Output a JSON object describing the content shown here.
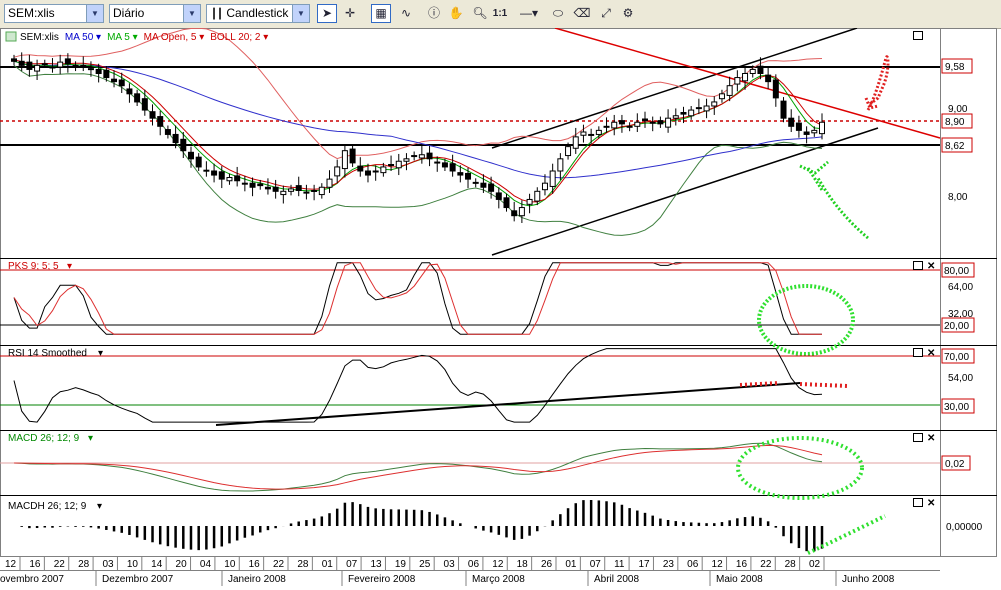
{
  "toolbar": {
    "symbol": "SEM:xlis",
    "period": "Diário",
    "chart_type": "Candlestick",
    "zoom_label": "1:1"
  },
  "panels": {
    "price": {
      "legend": [
        {
          "text": "SEM:xlis",
          "color": "#000000"
        },
        {
          "text": "MA 50",
          "color": "#0000cc"
        },
        {
          "text": "MA 5",
          "color": "#00aa00"
        },
        {
          "text": "MA Open, 5",
          "color": "#cc0000"
        },
        {
          "text": "BOLL 20; 2",
          "color": "#cc0000"
        }
      ],
      "axis_labels": [
        "9,58",
        "8,90",
        "8,62",
        "8,00"
      ],
      "ghost_label": "9,00"
    },
    "pks": {
      "title": "PKS 9; 5; 5",
      "color": "#cc0000",
      "axis_labels": [
        "80,00",
        "64,00",
        "32,00",
        "20,00"
      ]
    },
    "rsi": {
      "title": "RSI 14 Smoothed",
      "color": "#000000",
      "axis_labels": [
        "70,00",
        "54,00",
        "30,00"
      ]
    },
    "macd": {
      "title": "MACD 26; 12; 9",
      "color": "#008800",
      "axis_labels": [
        "0,02"
      ]
    },
    "macdh": {
      "title": "MACDH 26; 12; 9",
      "color": "#000000",
      "axis_labels": [
        "0,00000"
      ]
    }
  },
  "date_axis": {
    "days": [
      "12",
      "16",
      "22",
      "28",
      "03",
      "10",
      "14",
      "20",
      "04",
      "10",
      "16",
      "22",
      "28",
      "01",
      "07",
      "13",
      "19",
      "25",
      "03",
      "06",
      "12",
      "18",
      "26",
      "01",
      "07",
      "11",
      "17",
      "23",
      "06",
      "12",
      "16",
      "22",
      "28",
      "02"
    ],
    "months": [
      "ovembro 2007",
      "Dezembro 2007",
      "Janeiro 2008",
      "Fevereiro 2008",
      "Março 2008",
      "Abril 2008",
      "Maio 2008",
      "Junho 2008"
    ]
  },
  "chart_data": {
    "type": "candlestick",
    "symbol": "SEM:xlis",
    "period": "Diário",
    "date_range": "novembro 2007 – junho 2008",
    "close": [
      9.65,
      9.6,
      9.55,
      9.6,
      9.62,
      9.58,
      9.64,
      9.62,
      9.58,
      9.6,
      9.55,
      9.5,
      9.45,
      9.4,
      9.35,
      9.25,
      9.15,
      9.05,
      8.95,
      8.85,
      8.75,
      8.65,
      8.55,
      8.45,
      8.35,
      8.3,
      8.25,
      8.2,
      8.22,
      8.18,
      8.15,
      8.1,
      8.12,
      8.08,
      8.05,
      8.05,
      8.08,
      8.06,
      8.04,
      8.05,
      8.1,
      8.2,
      8.35,
      8.55,
      8.4,
      8.3,
      8.25,
      8.3,
      8.35,
      8.38,
      8.42,
      8.45,
      8.48,
      8.5,
      8.45,
      8.4,
      8.35,
      8.3,
      8.25,
      8.2,
      8.15,
      8.1,
      8.05,
      7.95,
      7.85,
      7.75,
      7.85,
      7.95,
      8.05,
      8.15,
      8.3,
      8.45,
      8.6,
      8.72,
      8.78,
      8.75,
      8.8,
      8.85,
      8.9,
      8.88,
      8.85,
      8.9,
      8.92,
      8.9,
      8.88,
      8.95,
      8.98,
      9.0,
      9.05,
      9.08,
      9.1,
      9.15,
      9.25,
      9.35,
      9.45,
      9.5,
      9.55,
      9.5,
      9.4,
      9.2,
      8.95,
      8.85,
      8.8,
      8.75,
      8.8,
      8.9
    ],
    "horizontal_levels": [
      9.58,
      8.9,
      8.62
    ],
    "indicators": [
      "MA 50",
      "MA 5",
      "MA Open, 5",
      "BOLL 20; 2",
      "PKS 9; 5; 5",
      "RSI 14 Smoothed",
      "MACD 26; 12; 9",
      "MACDH 26; 12; 9"
    ],
    "pks_levels": [
      80,
      20
    ],
    "rsi_levels": [
      70,
      30
    ]
  }
}
